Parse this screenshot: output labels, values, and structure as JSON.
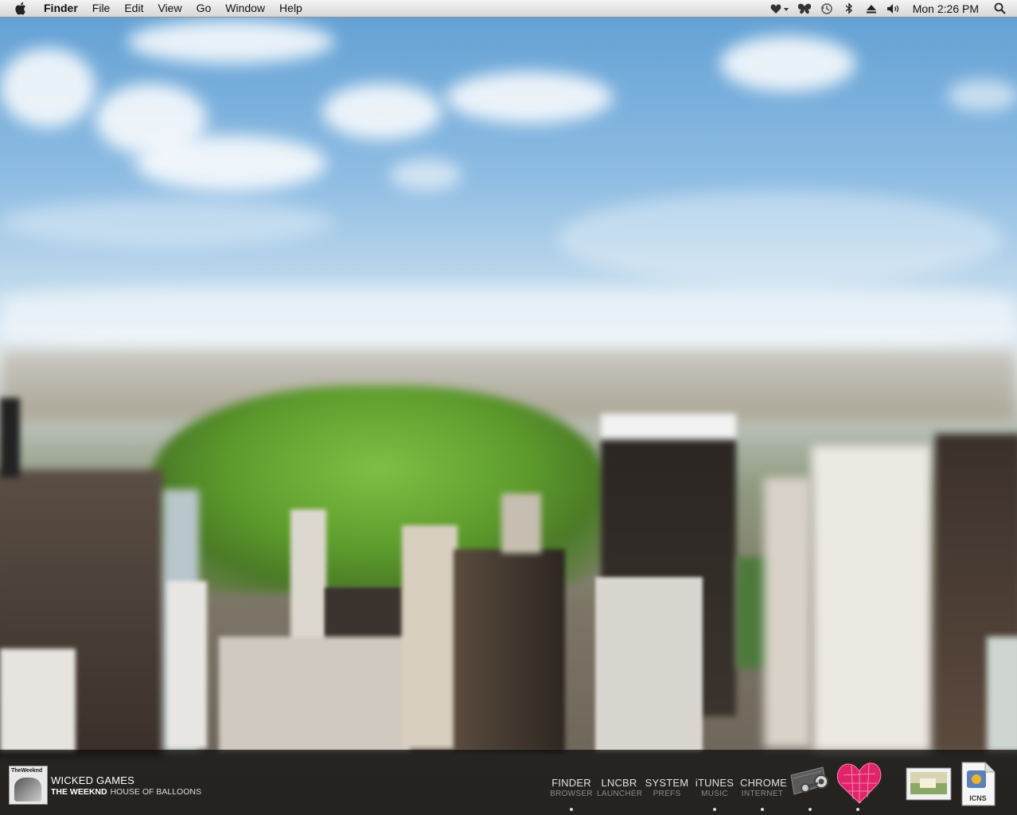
{
  "menubar": {
    "apple_icon": "apple-logo-icon",
    "app_name": "Finder",
    "menus": [
      "File",
      "Edit",
      "View",
      "Go",
      "Window",
      "Help"
    ],
    "status_icons": [
      "heart-dropdown-icon",
      "butterfly-icon",
      "time-machine-icon",
      "bluetooth-icon",
      "eject-icon",
      "volume-icon"
    ],
    "clock": "Mon 2:26 PM",
    "spotlight_icon": "search-icon"
  },
  "now_playing": {
    "album_art_text": "TheWeeknd",
    "title": "WICKED GAMES",
    "artist": "THE WEEKND",
    "album": "HOUSE OF BALLOONS"
  },
  "launchers": [
    {
      "name": "FINDER",
      "desc": "BROWSER"
    },
    {
      "name": "LNCBR",
      "desc": "LAUNCHER"
    },
    {
      "name": "SYSTEM",
      "desc": "PREFS"
    },
    {
      "name": "iTUNES",
      "desc": "MUSIC"
    },
    {
      "name": "CHROME",
      "desc": "INTERNET"
    }
  ],
  "dock_items": [
    "steam-icon",
    "heart-app-icon",
    "photo-preview-icon",
    "icns-file-icon"
  ],
  "icns_label": "ICNS",
  "colors": {
    "bar_bg": "#0a0a0a",
    "park_green": "#5e9d2c",
    "sky_blue": "#5f9ed3"
  }
}
